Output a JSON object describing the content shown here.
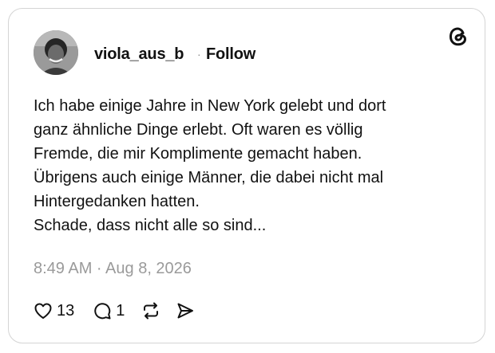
{
  "post": {
    "username": "viola_aus_b",
    "separator": "·",
    "follow_label": "Follow",
    "text": "Ich habe einige Jahre in New York gelebt und dort\nganz ähnliche Dinge erlebt. Oft waren es völlig\nFremde, die mir Komplimente gemacht haben.\nÜbrigens auch einige Männer, die dabei nicht mal\nHintergedanken hatten.\nSchade, dass nicht alle so sind...",
    "timestamp": "8:49 AM · Aug 8, 2026"
  },
  "actions": {
    "like_icon": "heart-icon",
    "like_count": "13",
    "reply_icon": "comment-icon",
    "reply_count": "1",
    "repost_icon": "repost-icon",
    "share_icon": "send-icon"
  },
  "brand": {
    "logo_icon": "threads-logo-icon"
  },
  "colors": {
    "text": "#111111",
    "muted": "#9a9a9a",
    "border": "#d4d4d4"
  }
}
